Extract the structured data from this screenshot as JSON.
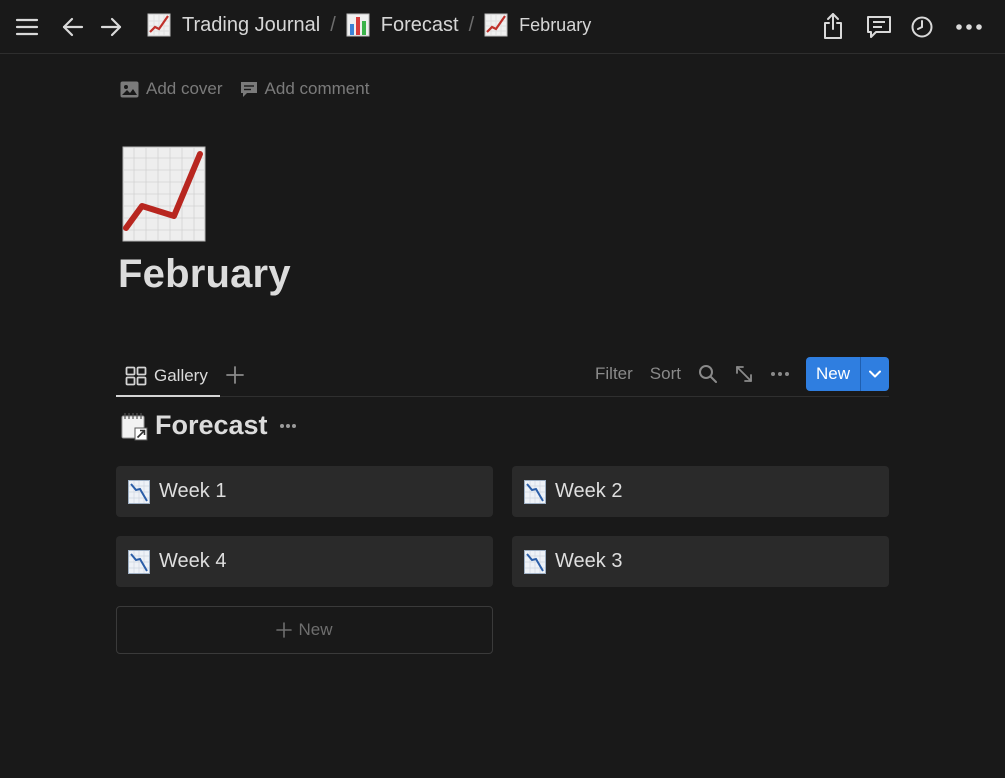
{
  "topbar": {
    "breadcrumbs": [
      {
        "label": "Trading Journal",
        "icon": "chart-increasing-emoji"
      },
      {
        "label": "Forecast",
        "icon": "bar-chart-emoji"
      },
      {
        "label": "February",
        "icon": "chart-increasing-emoji"
      }
    ],
    "separator": "/"
  },
  "page": {
    "add_cover_label": "Add cover",
    "add_comment_label": "Add comment",
    "icon": "chart-increasing-emoji",
    "title": "February"
  },
  "view_bar": {
    "tab_label": "Gallery",
    "filter_label": "Filter",
    "sort_label": "Sort",
    "new_label": "New"
  },
  "database": {
    "title": "Forecast",
    "icon": "linked-database-emoji",
    "cards": [
      {
        "label": "Week 1",
        "icon": "chart-decreasing-emoji"
      },
      {
        "label": "Week 2",
        "icon": "chart-decreasing-emoji"
      },
      {
        "label": "Week 4",
        "icon": "chart-decreasing-emoji"
      },
      {
        "label": "Week 3",
        "icon": "chart-decreasing-emoji"
      }
    ],
    "add_new_label": "New"
  },
  "colors": {
    "background": "#191919",
    "card": "#2a2a2a",
    "accent": "#2f7ee0",
    "chart_red": "#c0312b"
  }
}
